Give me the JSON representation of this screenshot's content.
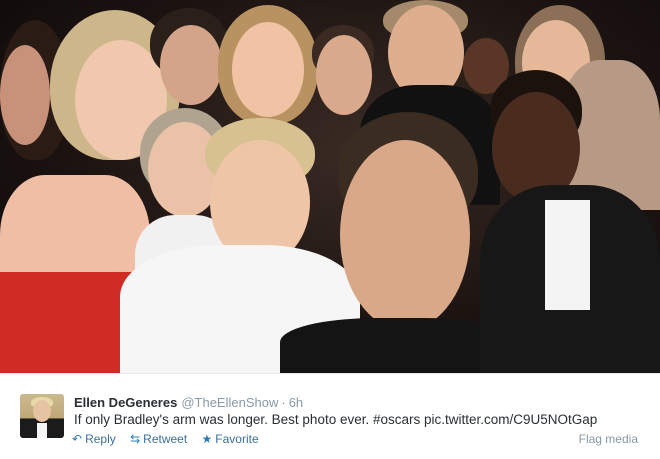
{
  "tweet": {
    "author_name": "Ellen DeGeneres",
    "handle": "@TheEllenShow",
    "separator": "·",
    "time": "6h",
    "text": "If only Bradley's arm was longer. Best photo ever. #oscars pic.twitter.com/C9U5NOtGap"
  },
  "actions": {
    "reply_label": "Reply",
    "retweet_label": "Retweet",
    "favorite_label": "Favorite",
    "flag_label": "Flag media"
  },
  "icons": {
    "reply": "reply-icon",
    "retweet": "retweet-icon",
    "favorite": "star-icon"
  },
  "colors": {
    "link": "#3b6f9e",
    "muted": "#8899a6",
    "text": "#292f33"
  }
}
